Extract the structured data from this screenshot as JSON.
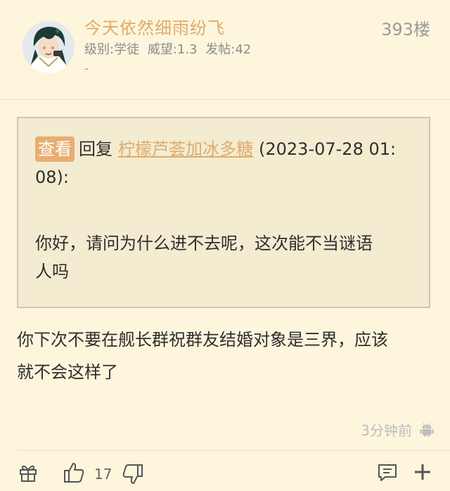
{
  "post": {
    "username": "今天依然细雨纷飞",
    "level_label": "级别:学徒",
    "prestige_label": "威望:1.3",
    "posts_label": "发帖:42",
    "signature": "-",
    "floor": "393楼"
  },
  "quote": {
    "view_label": "查看",
    "reply_word": "回复",
    "reply_to_user": "柠檬芦荟加冰多糖",
    "timestamp_part1": "(2023-07-28 01:",
    "timestamp_part2": "08):",
    "text_line1": "你好，请问为什么进不去呢，这次能不当谜语",
    "text_line2": "人吗"
  },
  "body": {
    "line1": "你下次不要在舰长群祝群友结婚对象是三界，应该",
    "line2": "就不会这样了"
  },
  "footer": {
    "time": "3分钟前",
    "platform_icon": "android-icon",
    "like_count": "17"
  },
  "colors": {
    "background": "#fdf6dd",
    "accent": "#e0ab6c",
    "badge": "#e8ae72",
    "quote_bg": "#f3ecd1"
  }
}
